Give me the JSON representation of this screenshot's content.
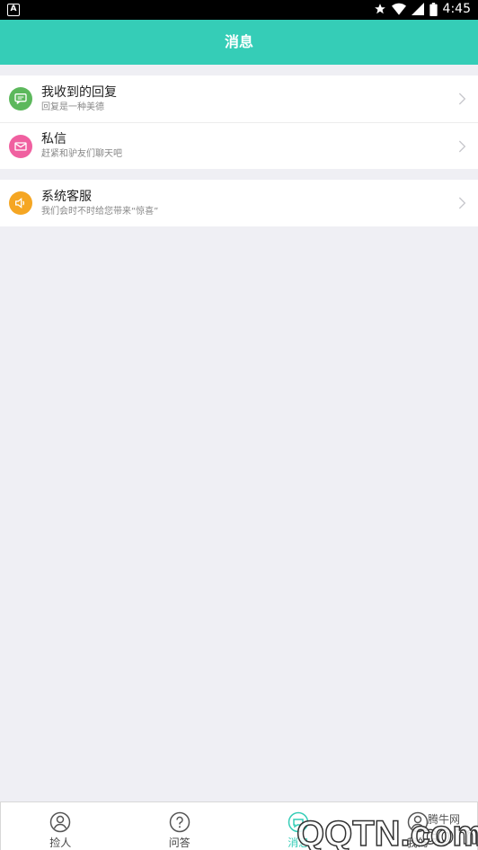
{
  "status_bar": {
    "left_icon_label": "A",
    "time": "4:45"
  },
  "header": {
    "title": "消息"
  },
  "messages": [
    {
      "title": "我收到的回复",
      "subtitle": "回复是一种美德",
      "icon": "chat-bubble-icon",
      "color": "#5cb85c"
    },
    {
      "title": "私信",
      "subtitle": "赶紧和驴友们聊天吧",
      "icon": "envelope-icon",
      "color": "#f060a0"
    }
  ],
  "service": {
    "title": "系统客服",
    "subtitle": "我们会时不时给您带来“惊喜”",
    "icon": "speaker-icon",
    "color": "#f5a623"
  },
  "tabs": [
    {
      "label": "捡人",
      "icon": "person-icon"
    },
    {
      "label": "问答",
      "icon": "question-icon"
    },
    {
      "label": "消息",
      "icon": "message-icon",
      "active": true
    },
    {
      "label": "我的",
      "icon": "profile-icon"
    }
  ],
  "watermark": {
    "site": "腾牛网",
    "text": "QQTN.com"
  },
  "colors": {
    "accent": "#35cdb7",
    "background": "#efeff4"
  }
}
